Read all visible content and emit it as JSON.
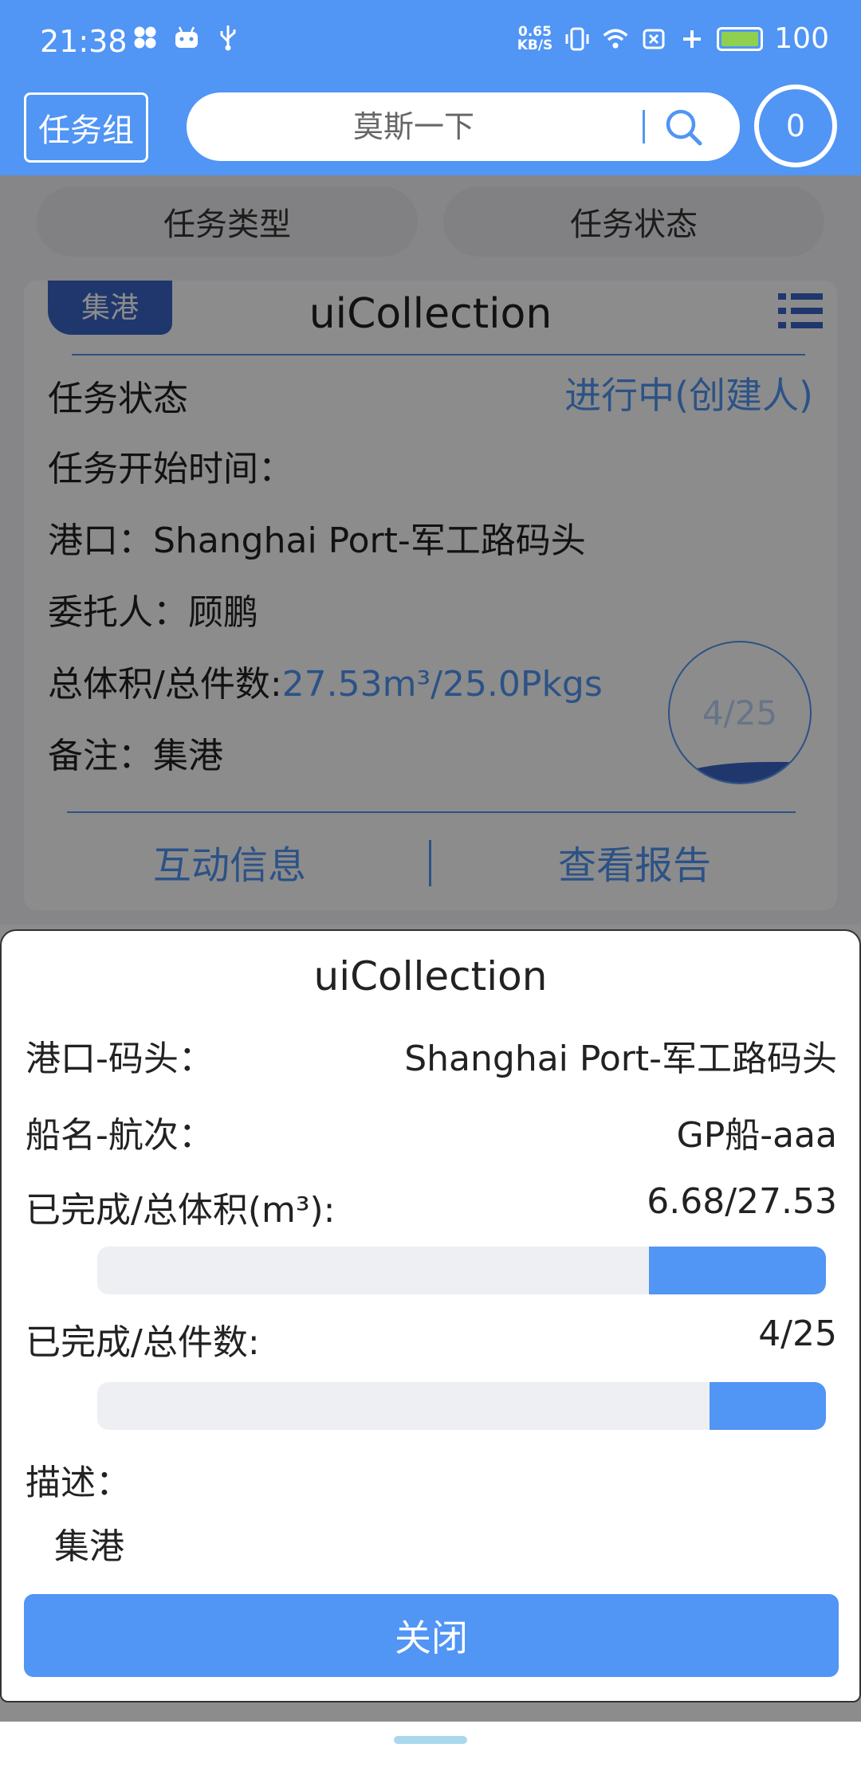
{
  "status_bar": {
    "time": "21:38",
    "net_speed_value": "0.65",
    "net_speed_unit": "KB/S",
    "battery": "100"
  },
  "header": {
    "group_button": "任务组",
    "search_placeholder": "莫斯一下",
    "count": "0"
  },
  "filters": {
    "type": "任务类型",
    "status": "任务状态"
  },
  "card": {
    "tag": "集港",
    "title": "uiCollection",
    "status_label": "任务状态",
    "status_value": "进行中(创建人)",
    "start_time_label": "任务开始时间：",
    "port_label": "港口：",
    "port_value": "Shanghai Port-军工路码头",
    "client_label": "委托人：",
    "client_value": "顾鹏",
    "volume_label": "总体积/总件数:",
    "volume_value": "27.53m³/25.0Pkgs",
    "remark_label": "备注：",
    "remark_value": "集港",
    "progress_text": "4/25",
    "progress_fraction": 0.16,
    "btn_interact": "互动信息",
    "btn_report": "查看报告"
  },
  "sheet": {
    "title": "uiCollection",
    "port_label": "港口-码头：",
    "port_value": "Shanghai Port-军工路码头",
    "ship_label": "船名-航次：",
    "ship_value": "GP船-aaa",
    "volume_label": "已完成/总体积(m³):",
    "volume_value": "6.68/27.53",
    "volume_fraction": 0.2426,
    "pieces_label": "已完成/总件数:",
    "pieces_value": "4/25",
    "pieces_fraction": 0.16,
    "desc_label": "描述：",
    "desc_value": "集港",
    "close_button": "关闭"
  },
  "colors": {
    "primary": "#5195f5",
    "tag": "#3a65c7"
  }
}
